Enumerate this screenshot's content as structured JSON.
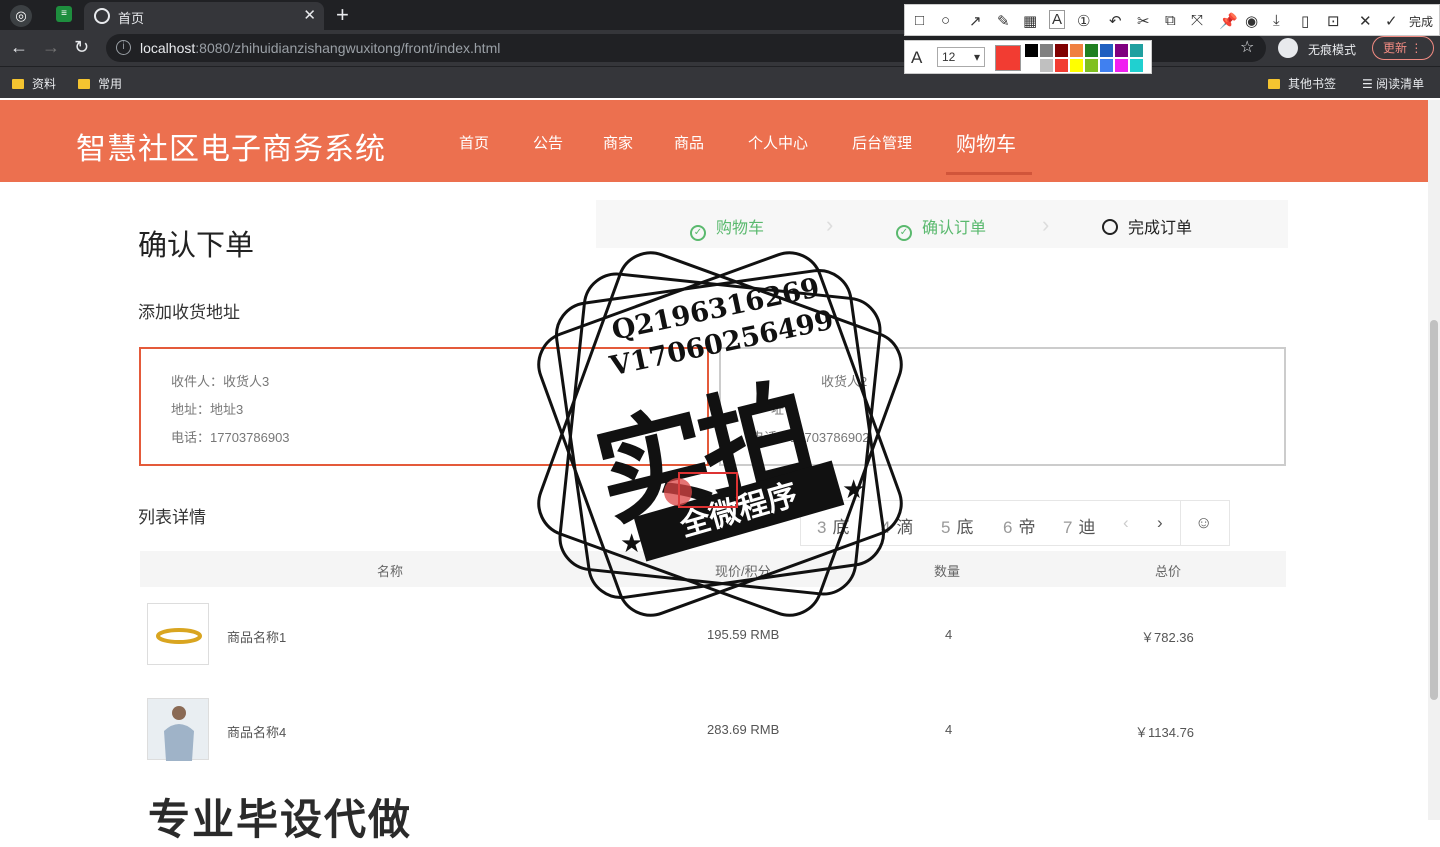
{
  "browser": {
    "tab_title": "首页",
    "url_host": "localhost",
    "url_rest": ":8080/zhihuidianzishangwuxitong/front/index.html",
    "incognito_label": "无痕模式",
    "update_label": "更新",
    "bookmarks": [
      "资料",
      "常用"
    ],
    "bookmarks_right": [
      "其他书签",
      "阅读清单"
    ]
  },
  "capture_tool": {
    "done_label": "完成",
    "font_size": "12",
    "current_color": "#f23c32",
    "swatches": [
      "#000000",
      "#808080",
      "#800000",
      "#f08040",
      "#208020",
      "#2060c0",
      "#800080",
      "#20a0a0",
      "#ffffff",
      "#c0c0c0",
      "#f23c32",
      "#ffff00",
      "#80c020",
      "#4080f0",
      "#f020f0",
      "#20d0d0"
    ]
  },
  "site": {
    "name": "智慧社区电子商务系统",
    "menu": [
      "首页",
      "公告",
      "商家",
      "商品",
      "个人中心",
      "后台管理",
      "购物车"
    ]
  },
  "page": {
    "title": "确认下单",
    "steps": [
      "购物车",
      "确认订单",
      "完成订单"
    ],
    "address_section": "添加收货地址",
    "addresses": [
      {
        "name": "收件人：收货人3",
        "addr": "地址：地址3",
        "phone": "电话：17703786903"
      },
      {
        "name": "收货人2",
        "addr": "址",
        "phone": "电话：17703786902"
      }
    ],
    "list_section": "列表详情",
    "pager": [
      {
        "n": "3",
        "t": "底"
      },
      {
        "n": "4",
        "t": "滴"
      },
      {
        "n": "5",
        "t": "底"
      },
      {
        "n": "6",
        "t": "帝"
      },
      {
        "n": "7",
        "t": "迪"
      }
    ],
    "table_headers": [
      "名称",
      "现价/积分",
      "数量",
      "总价"
    ],
    "rows": [
      {
        "name": "商品名称1",
        "price": "195.59 RMB",
        "qty": "4",
        "total": "￥782.36"
      },
      {
        "name": "商品名称4",
        "price": "283.69 RMB",
        "qty": "4",
        "total": "￥1134.76"
      }
    ]
  },
  "watermark": {
    "qq": "Q2196316269",
    "vx": "V17060256499",
    "big": "实拍",
    "ribbon": "全微程序",
    "bottom": "专业毕设代做"
  }
}
